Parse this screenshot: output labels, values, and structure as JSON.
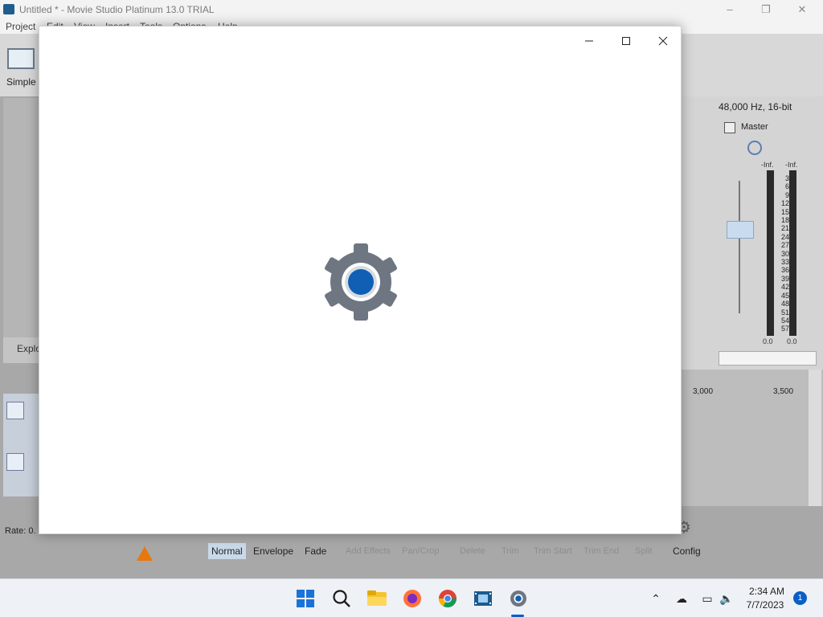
{
  "background_app": {
    "title": "Untitled * - Movie Studio Platinum 13.0 TRIAL",
    "menu": [
      "Project",
      "Edit",
      "View",
      "Insert",
      "Tools",
      "Options",
      "Help"
    ],
    "toolbar": {
      "simple_label": "Simple"
    },
    "left_panel": {
      "explorer_label": "Explo"
    },
    "mixer": {
      "format": "48,000 Hz, 16-bit",
      "master_label": "Master",
      "inf_left": "-Inf.",
      "inf_right": "-Inf.",
      "scale": [
        "3",
        "6",
        "9",
        "12",
        "15",
        "18",
        "21",
        "24",
        "27",
        "30",
        "33",
        "36",
        "39",
        "42",
        "45",
        "48",
        "51",
        "54",
        "57"
      ],
      "zero_left": "0.0",
      "zero_right": "0.0"
    },
    "timeline": {
      "tick_1": "3,000",
      "tick_2": "3,500"
    },
    "edit_toolbar": {
      "rate": "Rate: 0.",
      "modes": [
        "Normal",
        "Envelope",
        "Fade"
      ],
      "disabled_tools": [
        "Add Effects",
        "Pan/Crop",
        "Delete",
        "Trim",
        "Trim Start",
        "Trim End",
        "Split"
      ],
      "config_label": "Config"
    }
  },
  "splash_window": {
    "icon": "settings-gear-icon",
    "gear_outer_color": "#6e7681",
    "gear_inner_color": "#0f5fb5"
  },
  "taskbar": {
    "apps": [
      "start-icon",
      "search-icon",
      "file-explorer-icon",
      "firefox-icon",
      "chrome-icon",
      "movie-studio-icon",
      "settings-icon"
    ],
    "clock_time": "2:34 AM",
    "clock_date": "7/7/2023",
    "notification_count": "1"
  }
}
